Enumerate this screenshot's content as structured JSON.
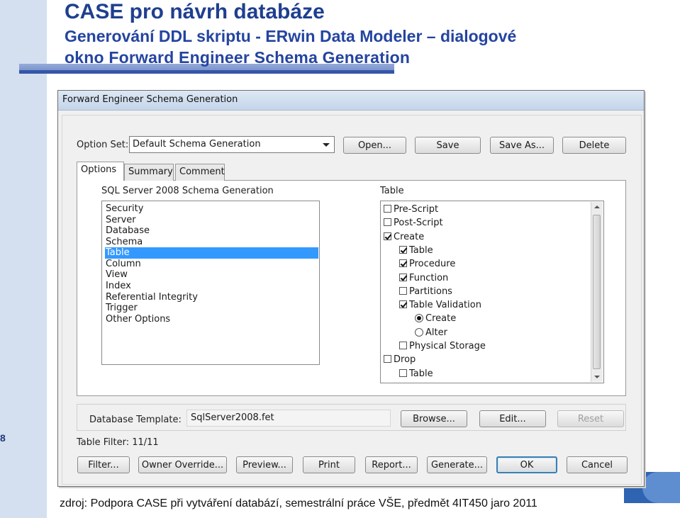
{
  "slide": {
    "title": "CASE pro návrh databáze",
    "subtitle_line1": "Generování DDL skriptu - ERwin Data Modeler – dialogové",
    "subtitle_line2": "okno Forward Engineer Schema Generation",
    "page_number": "8",
    "caption": "zdroj: Podpora CASE při vytváření databází, semestrální práce VŠE, předmět 4IT450 jaro 2011"
  },
  "dialog": {
    "title": "Forward Engineer Schema Generation",
    "option_set_label": "Option Set:",
    "option_set_value": "Default Schema Generation",
    "top_buttons": [
      "Open...",
      "Save",
      "Save As...",
      "Delete"
    ],
    "tabs": [
      "Options",
      "Summary",
      "Comment"
    ],
    "left_header": "SQL Server 2008 Schema Generation",
    "categories": [
      "Security",
      "Server",
      "Database",
      "Schema",
      "Table",
      "Column",
      "View",
      "Index",
      "Referential Integrity",
      "Trigger",
      "Other Options"
    ],
    "selected_category": "Table",
    "right_header": "Table",
    "tree": [
      {
        "label": "Pre-Script",
        "kind": "checkbox",
        "checked": false,
        "level": 0
      },
      {
        "label": "Post-Script",
        "kind": "checkbox",
        "checked": false,
        "level": 0
      },
      {
        "label": "Create",
        "kind": "checkbox",
        "checked": true,
        "level": 0
      },
      {
        "label": "Table",
        "kind": "checkbox",
        "checked": true,
        "level": 1
      },
      {
        "label": "Procedure",
        "kind": "checkbox",
        "checked": true,
        "level": 1
      },
      {
        "label": "Function",
        "kind": "checkbox",
        "checked": true,
        "level": 1
      },
      {
        "label": "Partitions",
        "kind": "checkbox",
        "checked": false,
        "level": 1
      },
      {
        "label": "Table Validation",
        "kind": "checkbox",
        "checked": true,
        "level": 1
      },
      {
        "label": "Create",
        "kind": "radio",
        "checked": true,
        "level": 2
      },
      {
        "label": "Alter",
        "kind": "radio",
        "checked": false,
        "level": 2
      },
      {
        "label": "Physical Storage",
        "kind": "checkbox",
        "checked": false,
        "level": 1
      },
      {
        "label": "Drop",
        "kind": "checkbox",
        "checked": false,
        "level": 0
      },
      {
        "label": "Table",
        "kind": "checkbox",
        "checked": false,
        "level": 1
      }
    ],
    "db_template_label": "Database Template:",
    "db_template_value": "SqlServer2008.fet",
    "browse_label": "Browse...",
    "edit_label": "Edit...",
    "reset_label": "Reset",
    "table_filter": "Table Filter: 11/11",
    "bottom_buttons": [
      "Filter...",
      "Owner Override...",
      "Preview...",
      "Print",
      "Report...",
      "Generate...",
      "OK",
      "Cancel"
    ]
  }
}
